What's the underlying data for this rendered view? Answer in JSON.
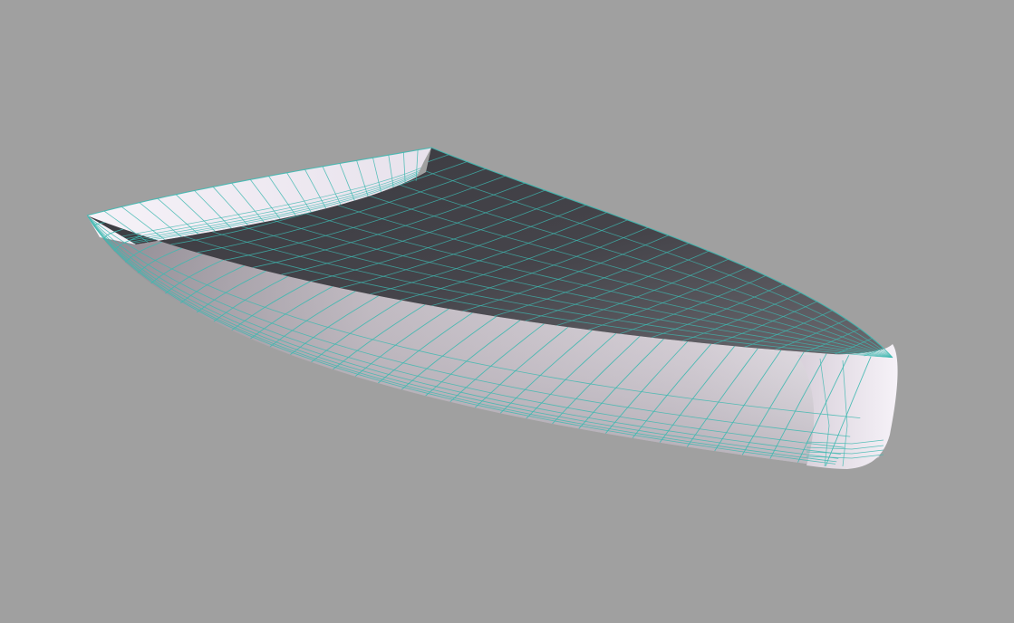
{
  "viewport": {
    "background": "#a0a0a0",
    "model": {
      "name": "hull-surface",
      "render_mode": "shaded-with-wireframe",
      "colors": {
        "exterior_light": "#f2eef4",
        "exterior_mid": "#c8c0c8",
        "exterior_dark": "#8a858d",
        "interior_dark": "#3e3e44",
        "interior_mid": "#5a595f",
        "wire": "#3fb8b0"
      }
    }
  }
}
